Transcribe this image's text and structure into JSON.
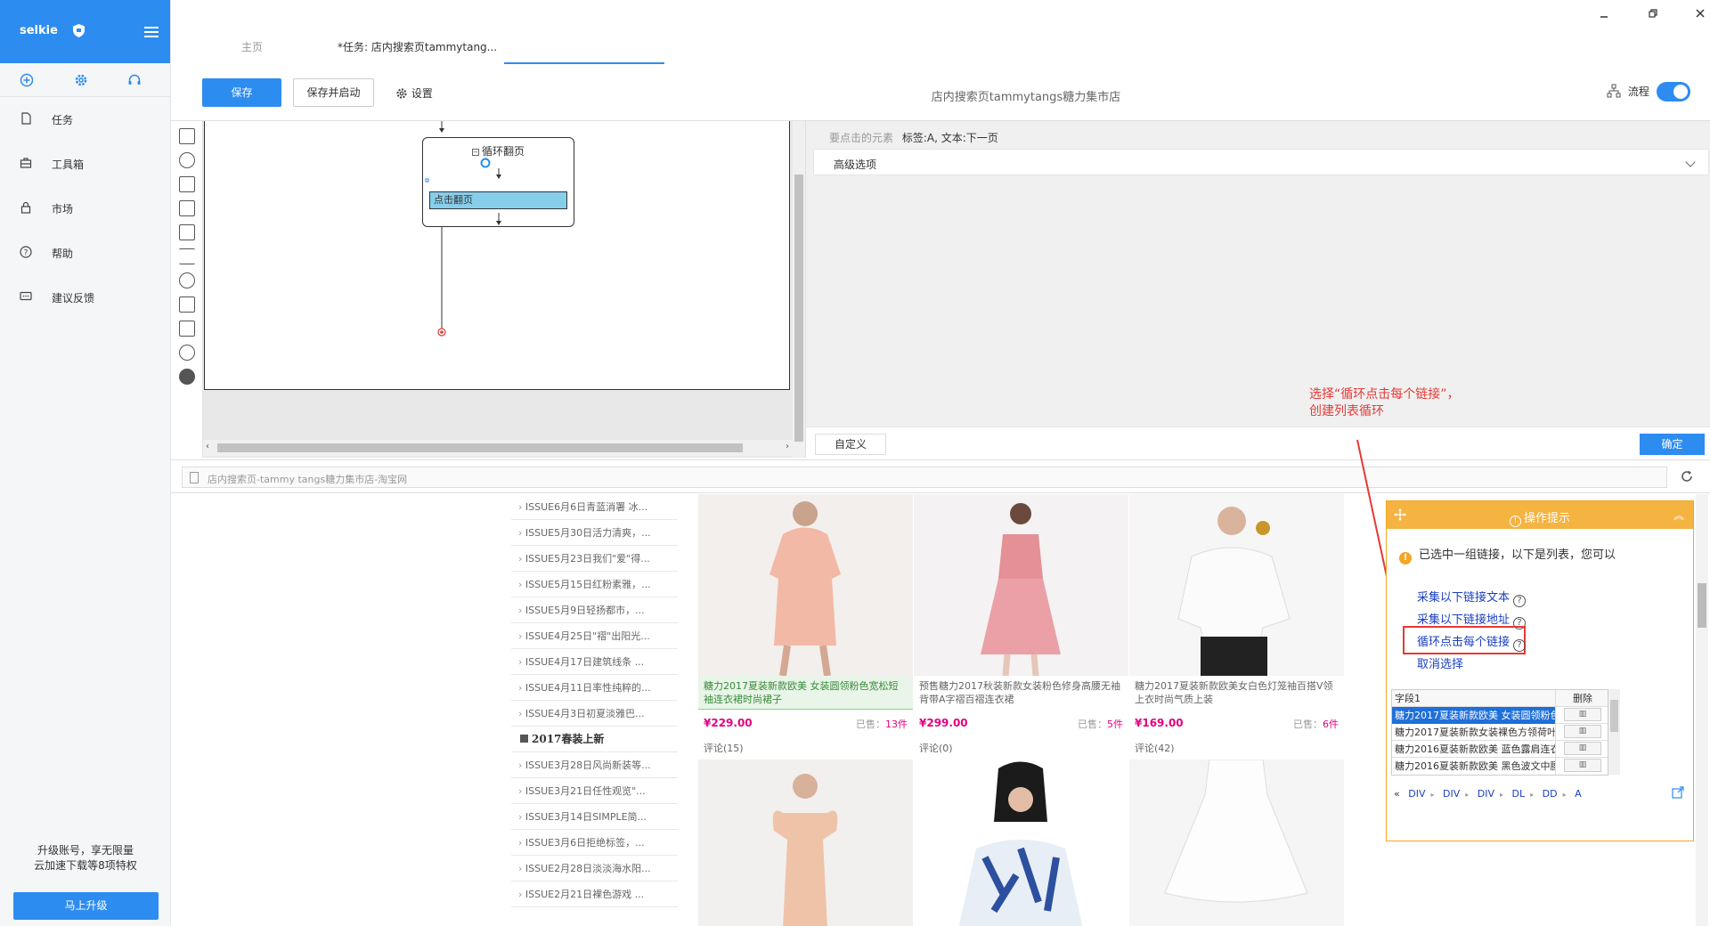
{
  "app": {
    "brand": "selkie"
  },
  "sidebar": {
    "items": [
      {
        "label": "任务",
        "icon": "document-icon"
      },
      {
        "label": "工具箱",
        "icon": "toolbox-icon"
      },
      {
        "label": "市场",
        "icon": "lock-icon"
      },
      {
        "label": "帮助",
        "icon": "help-icon"
      },
      {
        "label": "建议反馈",
        "icon": "feedback-icon"
      }
    ],
    "upgrade_text_1": "升级账号，享无限量",
    "upgrade_text_2": "云加速下载等8项特权",
    "upgrade_button": "马上升级"
  },
  "tabs": [
    {
      "label": "主页"
    },
    {
      "label": "*任务: 店内搜索页tammytang..."
    }
  ],
  "toolbar": {
    "save": "保存",
    "save_start": "保存并启动",
    "settings": "设置",
    "page_title": "店内搜索页tammytangs糖力集市店",
    "flow_label": "流程"
  },
  "designer": {
    "loop_title": "循环翻页",
    "click_step": "点击翻页"
  },
  "props": {
    "element_key": "要点击的元素",
    "element_value": "标签:A, 文本:下一页",
    "advanced": "高级选项",
    "custom_button": "自定义",
    "ok_button": "确定"
  },
  "annotation": {
    "line1": "选择“循环点击每个链接”，",
    "line2": "创建列表循环"
  },
  "browser": {
    "url": "店内搜索页-tammy tangs糖力集市店-淘宝网"
  },
  "issues": [
    "ISSUE6月6日青蓝消署 冰...",
    "ISSUE5月30日活力清爽，...",
    "ISSUE5月23日我们\"爱\"得...",
    "ISSUE5月15日红粉素雅，...",
    "ISSUE5月9日轻扬都市，...",
    "ISSUE4月25日\"褶\"出阳光...",
    "ISSUE4月17日建筑线条 ...",
    "ISSUE4月11日率性纯粹的...",
    "ISSUE4月3日初夏淡雅巴...",
    "2017春装上新",
    "ISSUE3月28日风尚新装等...",
    "ISSUE3月21日任性观览\"...",
    "ISSUE3月14日SIMPLE简...",
    "ISSUE3月6日拒绝标签，...",
    "ISSUE2月28日淡淡海水阳...",
    "ISSUE2月21日裸色游戏 ..."
  ],
  "products": [
    {
      "title": "糖力2017夏装新款欧美 女装圆领粉色宽松短袖连衣裙时尚裙子",
      "price": "¥229.00",
      "sold_label": "已售：",
      "sold": "13件",
      "reviews": "评论(15)"
    },
    {
      "title": "预售糖力2017秋装新款女装粉色修身高腰无袖背带A字褶百褶连衣裙",
      "price": "¥299.00",
      "sold_label": "已售：",
      "sold": "5件",
      "reviews": "评论(0)"
    },
    {
      "title": "糖力2017夏装新款欧美女白色灯笼袖百搭V领上衣时尚气质上装",
      "price": "¥169.00",
      "sold_label": "已售：",
      "sold": "6件",
      "reviews": "评论(42)"
    },
    {
      "title": "",
      "price": "",
      "sold_label": "",
      "sold": "",
      "reviews": ""
    },
    {
      "title": "",
      "price": "",
      "sold_label": "",
      "sold": "",
      "reviews": ""
    },
    {
      "title": "",
      "price": "",
      "sold_label": "",
      "sold": "",
      "reviews": ""
    }
  ],
  "tips": {
    "header": "操作提示",
    "message": "已选中一组链接，以下是列表，您可以",
    "links": [
      "采集以下链接文本",
      "采集以下链接地址",
      "循环点击每个链接",
      "取消选择"
    ],
    "field_header": "字段1",
    "delete_header": "删除",
    "rows": [
      "糖力2017夏装新款欧美 女装圆领粉色...",
      "糖力2017夏装新款女装裸色方领荷叶...",
      "糖力2016夏装新款欧美 蓝色露肩连衣...",
      "糖力2016夏装新款欧美 黑色波文中腰..."
    ],
    "path": [
      "DIV",
      "DIV",
      "DIV",
      "DL",
      "DD",
      "A"
    ]
  },
  "colors": {
    "accent": "#2d8cf0",
    "tips_orange": "#f5b342",
    "price": "#e4007f",
    "annotation": "#e53935"
  }
}
